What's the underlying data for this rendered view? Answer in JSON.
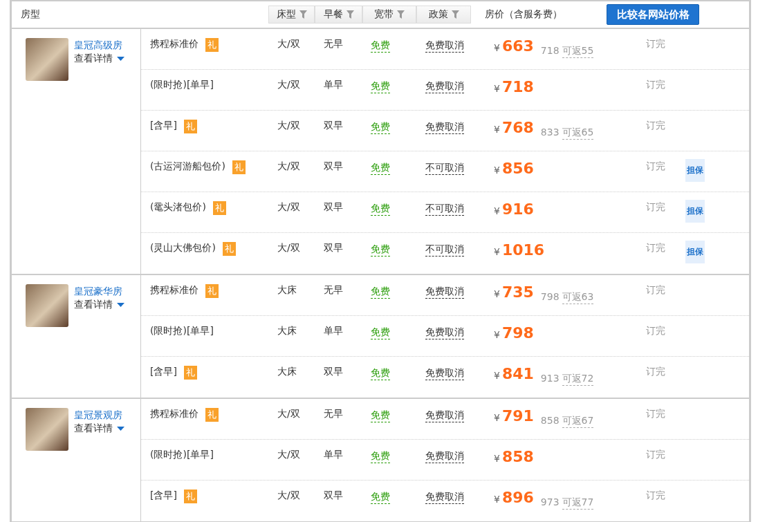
{
  "header": {
    "room_type": "房型",
    "filters": [
      {
        "label": "床型"
      },
      {
        "label": "早餐"
      },
      {
        "label": "宽带"
      },
      {
        "label": "政策"
      }
    ],
    "price": "房价（含服务费）",
    "compare_button": "比较各网站价格"
  },
  "rooms": [
    {
      "name": "皇冠高级房",
      "details": "查看详情",
      "rates": [
        {
          "name": "携程标准价",
          "gift": "礼",
          "bed": "大/双",
          "breakfast": "无早",
          "broadband": "免费",
          "policy": "免费取消",
          "currency": "¥",
          "price": "663",
          "original": "718",
          "cashback": "可返55",
          "status": "订完"
        },
        {
          "name": "(限时抢)[单早]",
          "bed": "大/双",
          "breakfast": "单早",
          "broadband": "免费",
          "policy": "免费取消",
          "currency": "¥",
          "price": "718",
          "status": "订完"
        },
        {
          "name": "[含早]",
          "gift": "礼",
          "bed": "大/双",
          "breakfast": "双早",
          "broadband": "免费",
          "policy": "免费取消",
          "currency": "¥",
          "price": "768",
          "original": "833",
          "cashback": "可返65",
          "status": "订完"
        },
        {
          "name": "(古运河游船包价)",
          "gift": "礼",
          "bed": "大/双",
          "breakfast": "双早",
          "broadband": "免费",
          "policy": "不可取消",
          "currency": "¥",
          "price": "856",
          "status": "订完",
          "guarantee": "担保"
        },
        {
          "name": "(鼋头渚包价)",
          "gift": "礼",
          "bed": "大/双",
          "breakfast": "双早",
          "broadband": "免费",
          "policy": "不可取消",
          "currency": "¥",
          "price": "916",
          "status": "订完",
          "guarantee": "担保"
        },
        {
          "name": "(灵山大佛包价)",
          "gift": "礼",
          "bed": "大/双",
          "breakfast": "双早",
          "broadband": "免费",
          "policy": "不可取消",
          "currency": "¥",
          "price": "1016",
          "status": "订完",
          "guarantee": "担保"
        }
      ]
    },
    {
      "name": "皇冠豪华房",
      "details": "查看详情",
      "rates": [
        {
          "name": "携程标准价",
          "gift": "礼",
          "bed": "大床",
          "breakfast": "无早",
          "broadband": "免费",
          "policy": "免费取消",
          "currency": "¥",
          "price": "735",
          "original": "798",
          "cashback": "可返63",
          "status": "订完"
        },
        {
          "name": "(限时抢)[单早]",
          "bed": "大床",
          "breakfast": "单早",
          "broadband": "免费",
          "policy": "免费取消",
          "currency": "¥",
          "price": "798",
          "status": "订完"
        },
        {
          "name": "[含早]",
          "gift": "礼",
          "bed": "大床",
          "breakfast": "双早",
          "broadband": "免费",
          "policy": "免费取消",
          "currency": "¥",
          "price": "841",
          "original": "913",
          "cashback": "可返72",
          "status": "订完"
        }
      ]
    },
    {
      "name": "皇冠景观房",
      "details": "查看详情",
      "rates": [
        {
          "name": "携程标准价",
          "gift": "礼",
          "bed": "大/双",
          "breakfast": "无早",
          "broadband": "免费",
          "policy": "免费取消",
          "currency": "¥",
          "price": "791",
          "original": "858",
          "cashback": "可返67",
          "status": "订完"
        },
        {
          "name": "(限时抢)[单早]",
          "bed": "大/双",
          "breakfast": "单早",
          "broadband": "免费",
          "policy": "免费取消",
          "currency": "¥",
          "price": "858",
          "status": "订完"
        },
        {
          "name": "[含早]",
          "gift": "礼",
          "bed": "大/双",
          "breakfast": "双早",
          "broadband": "免费",
          "policy": "免费取消",
          "currency": "¥",
          "price": "896",
          "original": "973",
          "cashback": "可返77",
          "status": "订完"
        }
      ]
    }
  ]
}
